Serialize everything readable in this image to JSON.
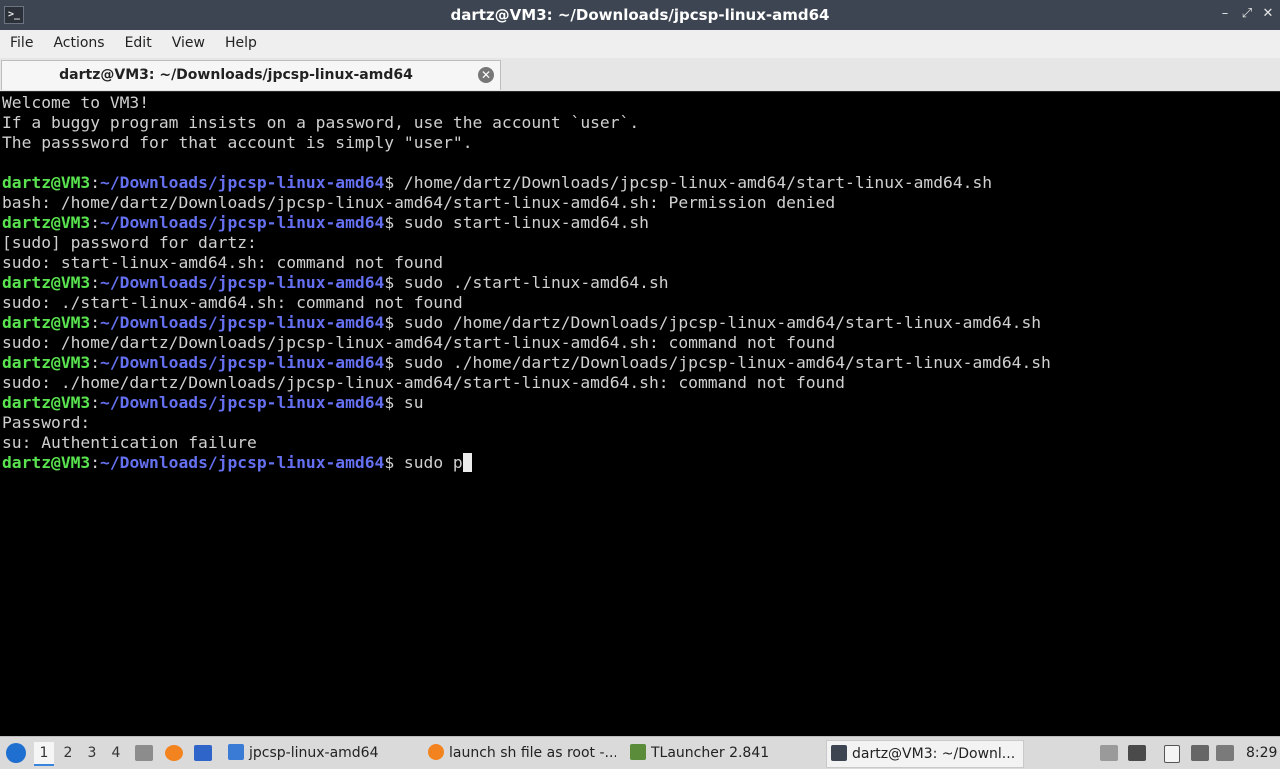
{
  "window": {
    "title": "dartz@VM3: ~/Downloads/jpcsp-linux-amd64"
  },
  "menu": [
    "File",
    "Actions",
    "Edit",
    "View",
    "Help"
  ],
  "tab": {
    "title": "dartz@VM3: ~/Downloads/jpcsp-linux-amd64"
  },
  "terminal": {
    "prompt_user": "dartz@VM3",
    "prompt_sep": ":",
    "prompt_path": "~/Downloads/jpcsp-linux-amd64",
    "prompt_symbol": "$ ",
    "lines": [
      {
        "type": "text",
        "text": "Welcome to VM3!"
      },
      {
        "type": "text",
        "text": "If a buggy program insists on a password, use the account `user`."
      },
      {
        "type": "text",
        "text": "The passsword for that account is simply \"user\"."
      },
      {
        "type": "text",
        "text": ""
      },
      {
        "type": "prompt",
        "cmd": "/home/dartz/Downloads/jpcsp-linux-amd64/start-linux-amd64.sh"
      },
      {
        "type": "text",
        "text": "bash: /home/dartz/Downloads/jpcsp-linux-amd64/start-linux-amd64.sh: Permission denied"
      },
      {
        "type": "prompt",
        "cmd": "sudo start-linux-amd64.sh"
      },
      {
        "type": "text",
        "text": "[sudo] password for dartz:"
      },
      {
        "type": "text",
        "text": "sudo: start-linux-amd64.sh: command not found"
      },
      {
        "type": "prompt",
        "cmd": "sudo ./start-linux-amd64.sh"
      },
      {
        "type": "text",
        "text": "sudo: ./start-linux-amd64.sh: command not found"
      },
      {
        "type": "prompt",
        "cmd": "sudo /home/dartz/Downloads/jpcsp-linux-amd64/start-linux-amd64.sh"
      },
      {
        "type": "text",
        "text": "sudo: /home/dartz/Downloads/jpcsp-linux-amd64/start-linux-amd64.sh: command not found"
      },
      {
        "type": "prompt",
        "cmd": "sudo ./home/dartz/Downloads/jpcsp-linux-amd64/start-linux-amd64.sh"
      },
      {
        "type": "text",
        "text": "sudo: ./home/dartz/Downloads/jpcsp-linux-amd64/start-linux-amd64.sh: command not found"
      },
      {
        "type": "prompt",
        "cmd": "su"
      },
      {
        "type": "text",
        "text": "Password:"
      },
      {
        "type": "text",
        "text": "su: Authentication failure"
      },
      {
        "type": "prompt",
        "cmd": "sudo p",
        "cursor": true
      }
    ]
  },
  "taskbar": {
    "workspaces": [
      "1",
      "2",
      "3",
      "4"
    ],
    "tasks": [
      {
        "label": "jpcsp-linux-amd64",
        "icon": "folder-icon"
      },
      {
        "label": "launch sh file as root -...",
        "icon": "firefox-icon"
      },
      {
        "label": "TLauncher 2.841",
        "icon": "minecraft-icon"
      },
      {
        "label": "dartz@VM3: ~/Downl...",
        "icon": "terminal-icon"
      }
    ],
    "clock": "8:29"
  },
  "colors": {
    "prompt_user": "#59e34f",
    "prompt_path": "#6470f0",
    "titlebar": "#3c4551"
  }
}
